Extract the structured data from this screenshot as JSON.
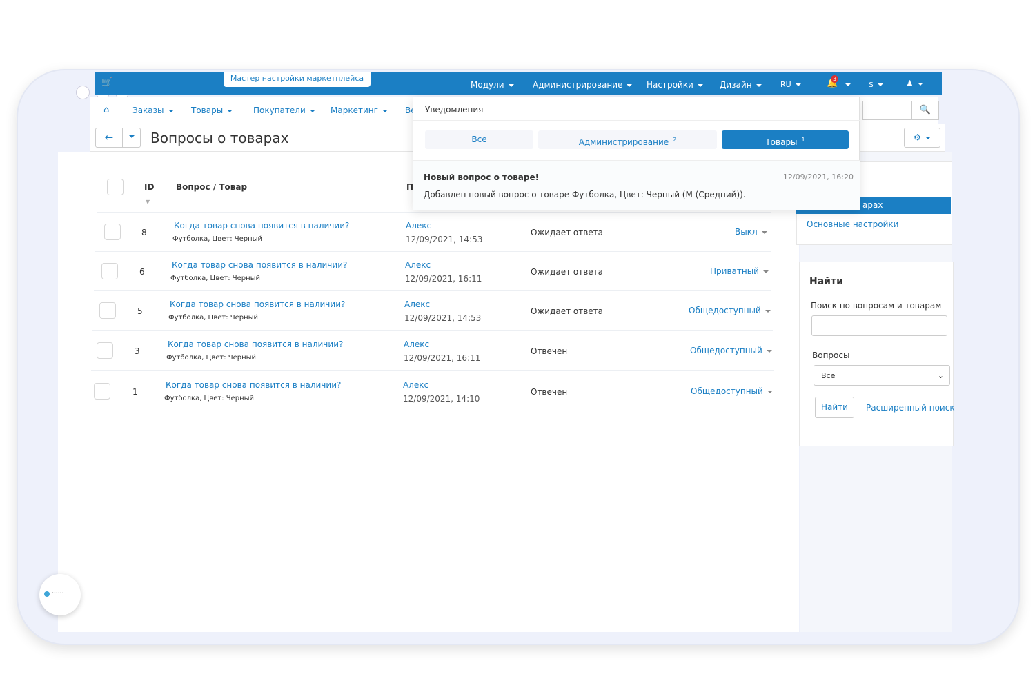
{
  "topbar": {
    "wizard_label": "Мастер настройки маркетплейса",
    "menu": [
      "Модули",
      "Администрирование",
      "Настройки",
      "Дизайн",
      "RU"
    ],
    "notif_count": "3",
    "currency": "$"
  },
  "subnav": {
    "items": [
      "Заказы",
      "Товары",
      "Покупатели",
      "Маркетинг",
      "Ве"
    ]
  },
  "page": {
    "title": "Вопросы о товарах"
  },
  "table": {
    "headers": {
      "id": "ID",
      "question": "Вопрос / Товар",
      "author": "П"
    },
    "rows": [
      {
        "id": "8",
        "question": "Когда товар снова появится в наличии?",
        "product": "Футболка, Цвет: Черный",
        "author": "Алекс",
        "date": "12/09/2021, 14:53",
        "status": "Ожидает ответа",
        "visibility": "Выкл"
      },
      {
        "id": "6",
        "question": "Когда товар снова появится в наличии?",
        "product": "Футболка, Цвет: Черный",
        "author": "Алекс",
        "date": "12/09/2021, 16:11",
        "status": "Ожидает ответа",
        "visibility": "Приватный"
      },
      {
        "id": "5",
        "question": "Когда товар снова появится в наличии?",
        "product": "Футболка, Цвет: Черный",
        "author": "Алекс",
        "date": "12/09/2021, 14:53",
        "status": "Ожидает ответа",
        "visibility": "Общедоступный"
      },
      {
        "id": "3",
        "question": "Когда товар снова появится в наличии?",
        "product": "Футболка, Цвет: Черный",
        "author": "Алекс",
        "date": "12/09/2021, 16:11",
        "status": "Отвечен",
        "visibility": "Общедоступный"
      },
      {
        "id": "1",
        "question": "Когда товар снова появится в наличии?",
        "product": "Футболка, Цвет: Черный",
        "author": "Алекс",
        "date": "12/09/2021, 14:10",
        "status": "Отвечен",
        "visibility": "Общедоступный"
      }
    ]
  },
  "notifications": {
    "title": "Уведомления",
    "tabs": [
      {
        "label": "Все",
        "count": ""
      },
      {
        "label": "Администрирование",
        "count": "2"
      },
      {
        "label": "Товары",
        "count": "1"
      }
    ],
    "item": {
      "title": "Новый вопрос о товаре!",
      "time": "12/09/2021, 16:20",
      "text": "Добавлен новый вопрос о товаре Футболка, Цвет: Черный (M (Средний))."
    }
  },
  "sidebar": {
    "active_item_visible": "арах",
    "settings_link": "Основные настройки",
    "search": {
      "heading": "Найти",
      "query_label": "Поиск по вопросам и товарам",
      "query_value": "",
      "questions_label": "Вопросы",
      "questions_selected": "Все",
      "find_button": "Найти",
      "advanced_link": "Расширенный поиск"
    }
  },
  "colors": {
    "accent": "#1b7fc4",
    "badge": "#dd3333"
  }
}
